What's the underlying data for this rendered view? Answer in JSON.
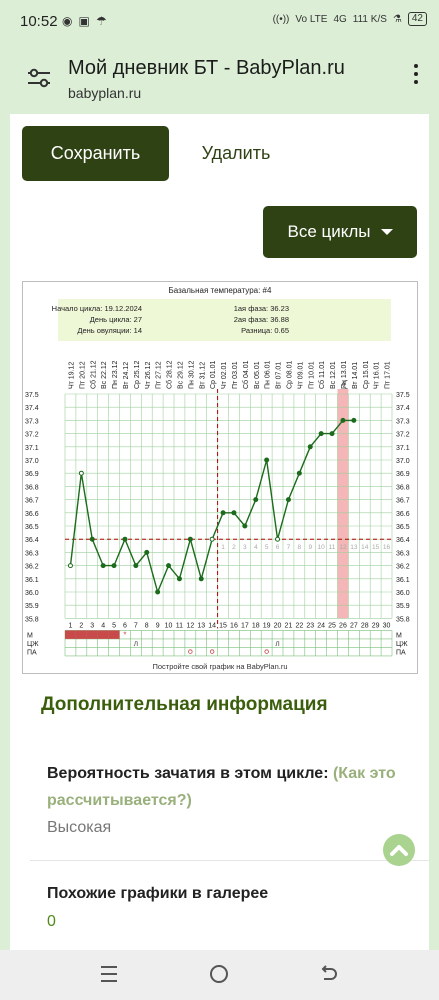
{
  "status": {
    "time": "10:52",
    "left_icons": [
      "whatsapp-icon",
      "office-icon",
      "umbrella-icon"
    ],
    "network": "Vo LTE",
    "signal": "4G",
    "speed": "111 K/S",
    "battery": "42"
  },
  "browser": {
    "title": "Мой дневник БТ - BabyPlan.ru",
    "url": "babyplan.ru"
  },
  "actions": {
    "save_label": "Сохранить",
    "delete_label": "Удалить",
    "cycles_label": "Все циклы"
  },
  "chart_data": {
    "type": "line",
    "title": "Базальная температура: #4",
    "info": {
      "cycle_start": "Начало цикла: 19.12.2024",
      "cycle_day": "День цикла: 27",
      "ovulation_day": "День овуляции: 14",
      "phase1": "1ая фаза: 36.23",
      "phase2": "2ая фаза: 36.88",
      "difference": "Разница: 0.65"
    },
    "dates": [
      "Чт 19.12",
      "Пт 20.12",
      "Сб 21.12",
      "Вс 22.12",
      "Пн 23.12",
      "Вт 24.12",
      "Ср 25.12",
      "Чт 26.12",
      "Пт 27.12",
      "Сб 28.12",
      "Вс 29.12",
      "Пн 30.12",
      "Вт 31.12",
      "Ср 01.01",
      "Чт 02.01",
      "Пт 03.01",
      "Сб 04.01",
      "Вс 05.01",
      "Пн 06.01",
      "Вт 07.01",
      "Ср 08.01",
      "Чт 09.01",
      "Пт 10.01",
      "Сб 11.01",
      "Вс 12.01",
      "Пн 13.01",
      "Вт 14.01",
      "Ср 15.01",
      "Чт 16.01",
      "Пт 17.01"
    ],
    "days": [
      1,
      2,
      3,
      4,
      5,
      6,
      7,
      8,
      9,
      10,
      11,
      12,
      13,
      14,
      15,
      16,
      17,
      18,
      19,
      20,
      21,
      22,
      23,
      24,
      25,
      26,
      27,
      28,
      29,
      30
    ],
    "temps": [
      36.2,
      36.9,
      36.4,
      36.2,
      36.2,
      36.4,
      36.2,
      36.3,
      36.0,
      36.2,
      36.1,
      36.4,
      36.1,
      36.4,
      36.6,
      36.6,
      36.5,
      36.7,
      37.0,
      36.4,
      36.7,
      36.9,
      37.1,
      37.2,
      37.2,
      37.3,
      37.3
    ],
    "y_ticks": [
      "37.5",
      "37.4",
      "37.3",
      "37.2",
      "37.1",
      "37.0",
      "36.9",
      "36.8",
      "36.7",
      "36.6",
      "36.5",
      "36.4",
      "36.3",
      "36.2",
      "36.1",
      "36.0",
      "35.9",
      "35.8"
    ],
    "ylim": [
      35.8,
      37.5
    ],
    "coverline": 36.4,
    "ovulation_day": 14,
    "luteal_days": [
      "1",
      "2",
      "3",
      "4",
      "5",
      "6",
      "7",
      "8",
      "9",
      "10",
      "11",
      "12",
      "13",
      "14",
      "15",
      "16"
    ],
    "highlight_day": 26,
    "menstruation_days": [
      1,
      2,
      3,
      4,
      5
    ],
    "spotting_day": 6,
    "row_labels": [
      "М",
      "ЦЖ",
      "ПА"
    ],
    "cm_marks": [
      {
        "day": 7,
        "text": "Л"
      },
      {
        "day": 20,
        "text": "Л"
      }
    ],
    "pa_days": [
      12,
      14,
      19
    ],
    "footer": "Постройте свой график на BabyPlan.ru",
    "colors": {
      "line": "#1d6b1d",
      "grid": "#9ecf9e",
      "ovulation": "#b00000",
      "highlight": "#f4b6b6",
      "menses": "#c84a4a"
    }
  },
  "details": {
    "section_title": "Дополнительная информация",
    "conception_label": "Вероятность зачатия в этом цикле:",
    "conception_link": "(Как это рассчитывается?)",
    "conception_value": "Высокая",
    "similar_label": "Похожие графики в галерее",
    "similar_value": "0"
  },
  "navbar": [
    "menu-icon",
    "home-icon",
    "back-icon"
  ]
}
